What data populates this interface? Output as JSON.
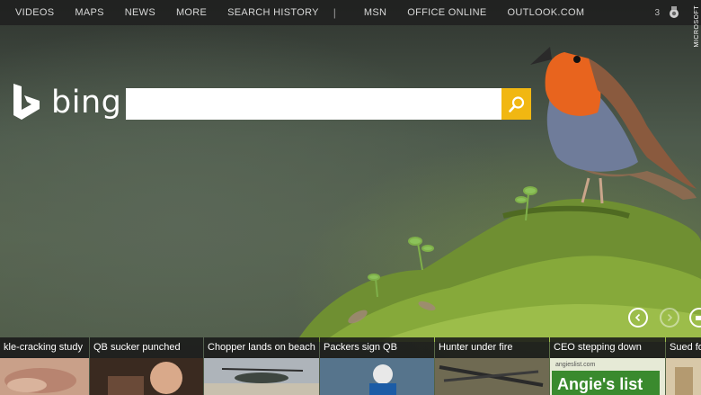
{
  "nav": {
    "left_items": [
      "VIDEOS",
      "MAPS",
      "NEWS",
      "MORE",
      "SEARCH HISTORY"
    ],
    "separator": "|",
    "right_items": [
      "MSN",
      "OFFICE ONLINE",
      "OUTLOOK.COM"
    ],
    "rewards_count": "3"
  },
  "watermark": "MICROSOFT",
  "logo": {
    "text": "bing"
  },
  "search": {
    "value": "",
    "placeholder": ""
  },
  "news": [
    {
      "label": "kle-cracking study"
    },
    {
      "label": "QB sucker punched"
    },
    {
      "label": "Chopper lands on beach"
    },
    {
      "label": "Packers sign QB"
    },
    {
      "label": "Hunter under fire"
    },
    {
      "label": "CEO stepping down"
    },
    {
      "label": "Sued fo"
    }
  ],
  "thumb_texts": {
    "ad": "Angie's list",
    "ad_small": "angieslist.com"
  },
  "colors": {
    "search_button": "#f1b712",
    "nav_bar": "#1e1e1e",
    "robin_breast": "#e8641e"
  },
  "icons": [
    "bing-logo-icon",
    "search-icon",
    "rewards-icon",
    "chevron-left-icon",
    "chevron-right-icon"
  ]
}
